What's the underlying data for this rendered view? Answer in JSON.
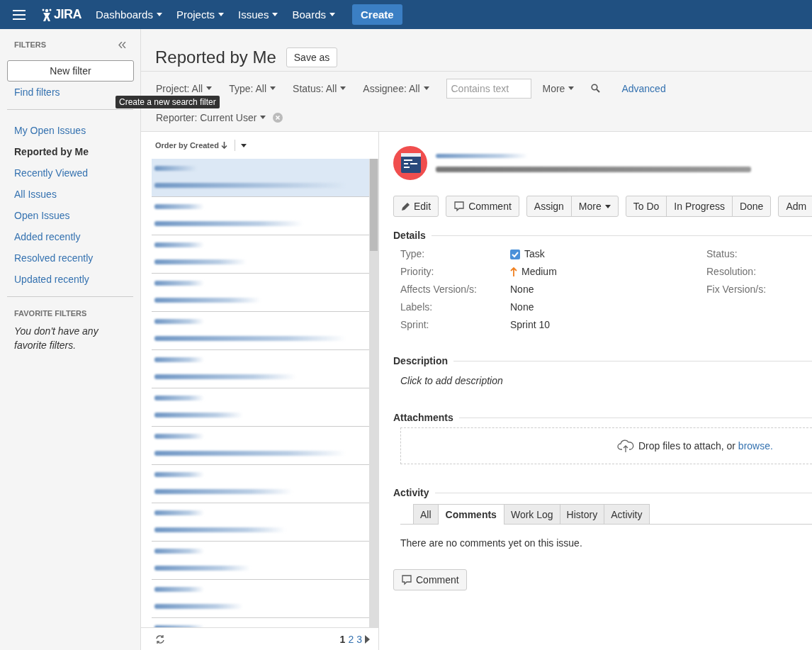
{
  "nav": {
    "logo": "JIRA",
    "menus": [
      "Dashboards",
      "Projects",
      "Issues",
      "Boards"
    ],
    "create": "Create"
  },
  "sidebar": {
    "heading": "FILTERS",
    "new_filter": "New filter",
    "find_filters": "Find filters",
    "items": [
      {
        "label": "My Open Issues",
        "selected": false
      },
      {
        "label": "Reported by Me",
        "selected": true
      },
      {
        "label": "Recently Viewed",
        "selected": false
      },
      {
        "label": "All Issues",
        "selected": false
      },
      {
        "label": "Open Issues",
        "selected": false
      },
      {
        "label": "Added recently",
        "selected": false
      },
      {
        "label": "Resolved recently",
        "selected": false
      },
      {
        "label": "Updated recently",
        "selected": false
      }
    ],
    "favorites_heading": "FAVORITE FILTERS",
    "favorites_empty": "You don't have any favorite filters."
  },
  "tooltip": "Create a new search filter",
  "page": {
    "title": "Reported by Me",
    "save_as": "Save as"
  },
  "filters": {
    "dropdowns": [
      "Project: All",
      "Type: All",
      "Status: All",
      "Assignee: All"
    ],
    "search": {
      "placeholder": "Contains text"
    },
    "more": "More",
    "advanced": "Advanced",
    "reporter": "Reporter: Current User"
  },
  "issue_list": {
    "order": "Order by Created",
    "rows": [
      {
        "selected": true
      },
      {
        "selected": false
      },
      {
        "selected": false
      },
      {
        "selected": false
      },
      {
        "selected": false
      },
      {
        "selected": false
      },
      {
        "selected": false
      },
      {
        "selected": false
      },
      {
        "selected": false
      },
      {
        "selected": false
      },
      {
        "selected": false
      },
      {
        "selected": false
      },
      {
        "selected": false
      }
    ],
    "pages": [
      {
        "label": "1",
        "selected": true
      },
      {
        "label": "2",
        "selected": false
      },
      {
        "label": "3",
        "selected": false
      }
    ]
  },
  "issue": {
    "button_groups": [
      [
        {
          "label": "Edit",
          "kind": "edit"
        }
      ],
      [
        {
          "label": "Comment",
          "kind": "comment"
        }
      ],
      [
        {
          "label": "Assign",
          "kind": "plain"
        },
        {
          "label": "More",
          "kind": "dropdown"
        }
      ],
      [
        {
          "label": "To Do",
          "kind": "plain"
        },
        {
          "label": "In Progress",
          "kind": "plain"
        },
        {
          "label": "Done",
          "kind": "plain"
        }
      ],
      [
        {
          "label": "Adm",
          "kind": "plain"
        }
      ]
    ],
    "details_heading": "Details",
    "fields": [
      {
        "label": "Type:",
        "value": "Task",
        "kind": "task"
      },
      {
        "label": "Priority:",
        "value": "Medium",
        "kind": "priority"
      },
      {
        "label": "Affects Version/s:",
        "value": "None",
        "kind": "plain"
      },
      {
        "label": "Labels:",
        "value": "None",
        "kind": "plain"
      },
      {
        "label": "Sprint:",
        "value": "Sprint 10",
        "kind": "plain"
      }
    ],
    "right_fields": [
      "Status:",
      "Resolution:",
      "Fix Version/s:"
    ],
    "description_heading": "Description",
    "description_placeholder": "Click to add description",
    "attachments_heading": "Attachments",
    "drop_text": "Drop files to attach, or",
    "browse": "browse.",
    "activity_heading": "Activity",
    "tabs": [
      {
        "label": "All",
        "selected": false
      },
      {
        "label": "Comments",
        "selected": true
      },
      {
        "label": "Work Log",
        "selected": false
      },
      {
        "label": "History",
        "selected": false
      },
      {
        "label": "Activity",
        "selected": false
      }
    ],
    "no_comments": "There are no comments yet on this issue.",
    "comment_button": "Comment"
  }
}
